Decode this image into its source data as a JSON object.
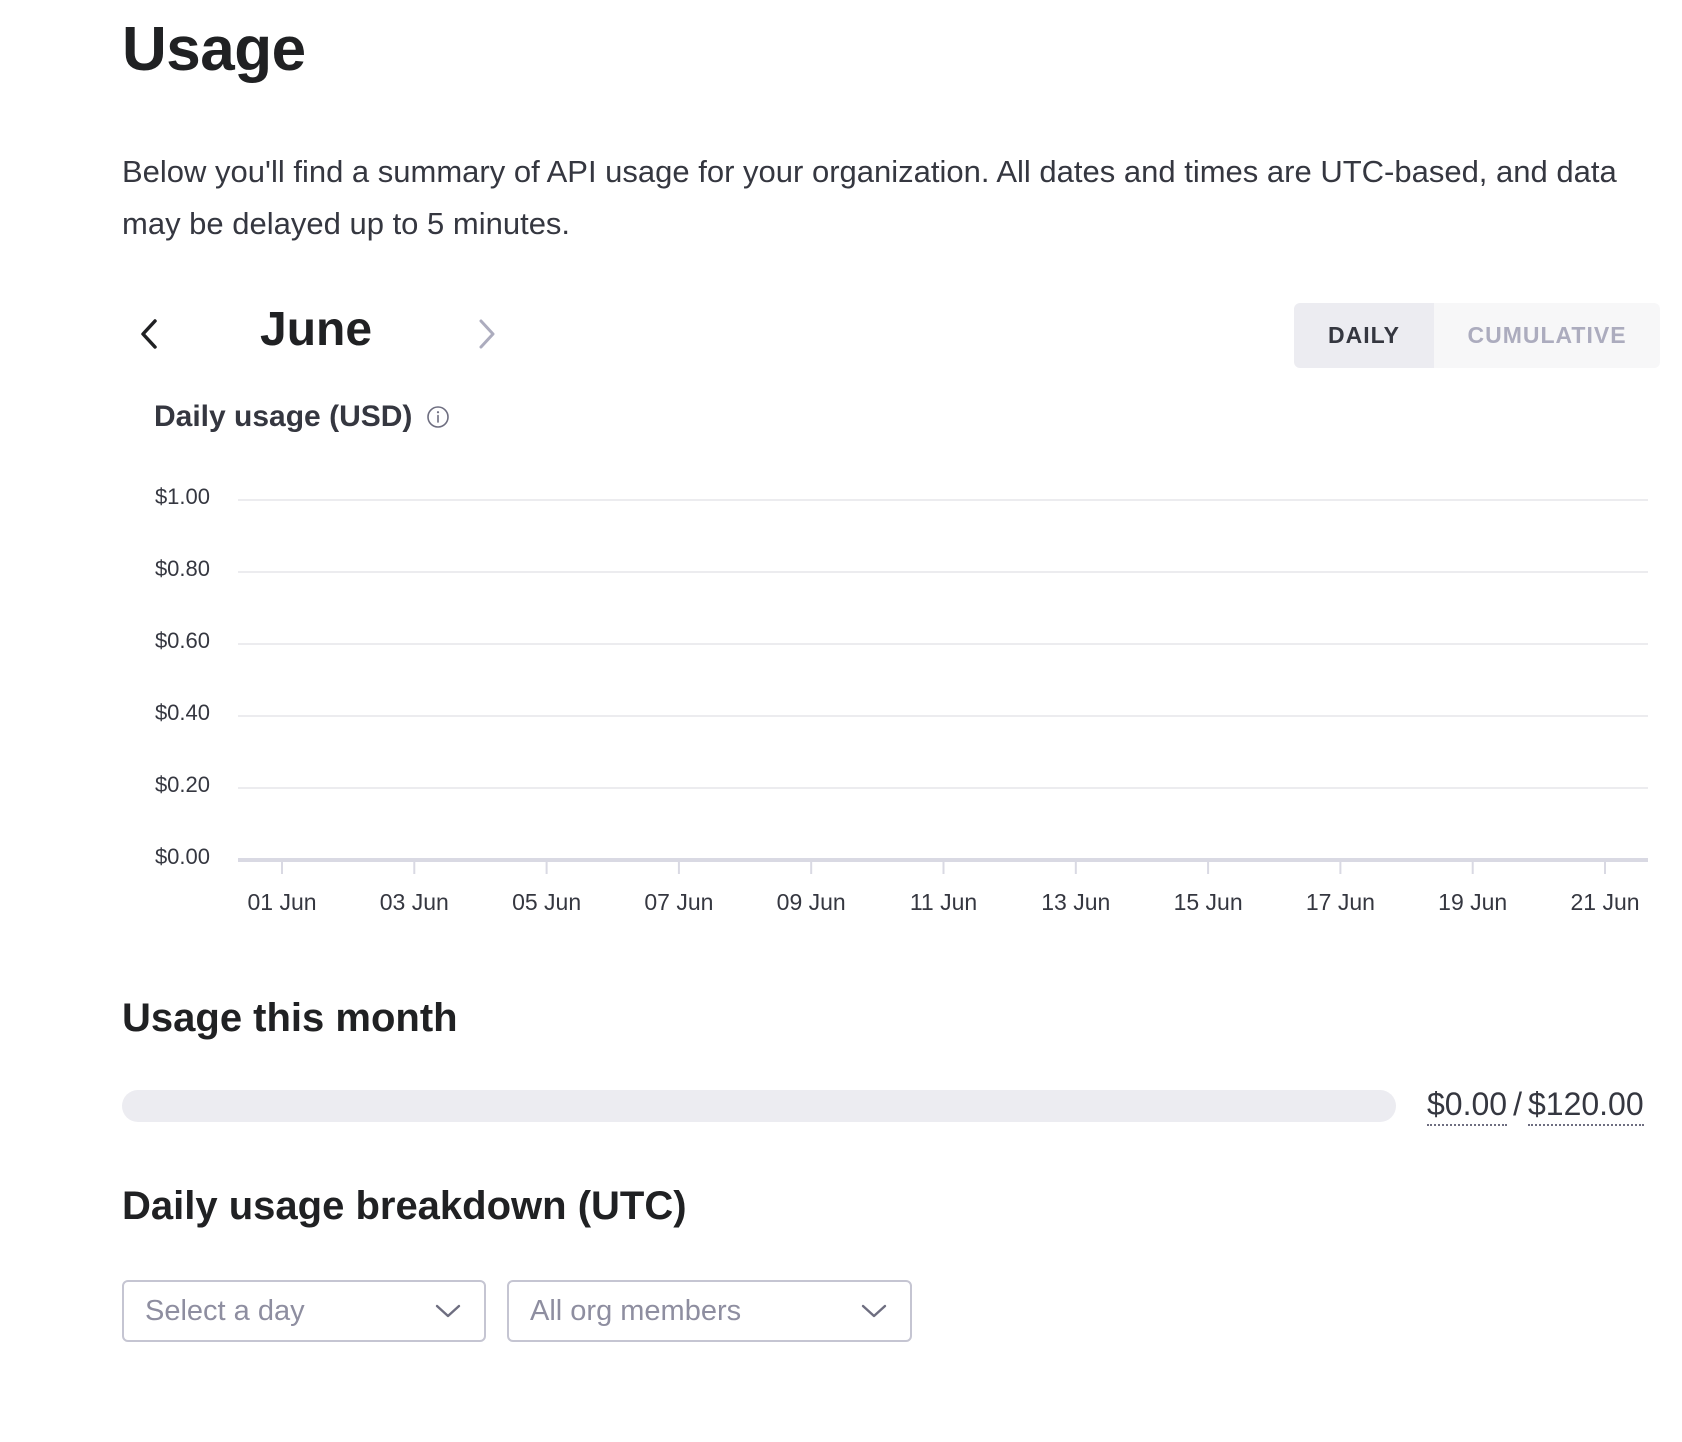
{
  "header": {
    "title": "Usage",
    "description": "Below you'll find a summary of API usage for your organization. All dates and times are UTC-based, and data may be delayed up to 5 minutes."
  },
  "month_nav": {
    "current_month": "June",
    "prev_icon": "chevron-left-icon",
    "next_icon": "chevron-right-icon"
  },
  "view_toggle": {
    "options": [
      "DAILY",
      "CUMULATIVE"
    ],
    "selected": "DAILY"
  },
  "chart": {
    "title": "Daily usage (USD)",
    "info_icon": "info-icon"
  },
  "chart_data": {
    "type": "bar",
    "title": "Daily usage (USD)",
    "xlabel": "",
    "ylabel": "",
    "categories": [
      "01 Jun",
      "03 Jun",
      "05 Jun",
      "07 Jun",
      "09 Jun",
      "11 Jun",
      "13 Jun",
      "15 Jun",
      "17 Jun",
      "19 Jun",
      "21 Jun"
    ],
    "values": [
      0,
      0,
      0,
      0,
      0,
      0,
      0,
      0,
      0,
      0,
      0
    ],
    "y_ticks": [
      "$1.00",
      "$0.80",
      "$0.60",
      "$0.40",
      "$0.20",
      "$0.00"
    ],
    "y_tick_values": [
      1.0,
      0.8,
      0.6,
      0.4,
      0.2,
      0.0
    ],
    "ylim": [
      0,
      1
    ],
    "grid": true
  },
  "usage_month": {
    "title": "Usage this month",
    "used": "$0.00",
    "limit": "$120.00",
    "separator": "/",
    "progress_fraction": 0
  },
  "breakdown": {
    "title": "Daily usage breakdown (UTC)",
    "day_select_placeholder": "Select a day",
    "members_select_value": "All org members"
  },
  "colors": {
    "accent": "#10a37f",
    "text": "#202123",
    "muted": "#acacbe",
    "track": "#ececf1"
  }
}
